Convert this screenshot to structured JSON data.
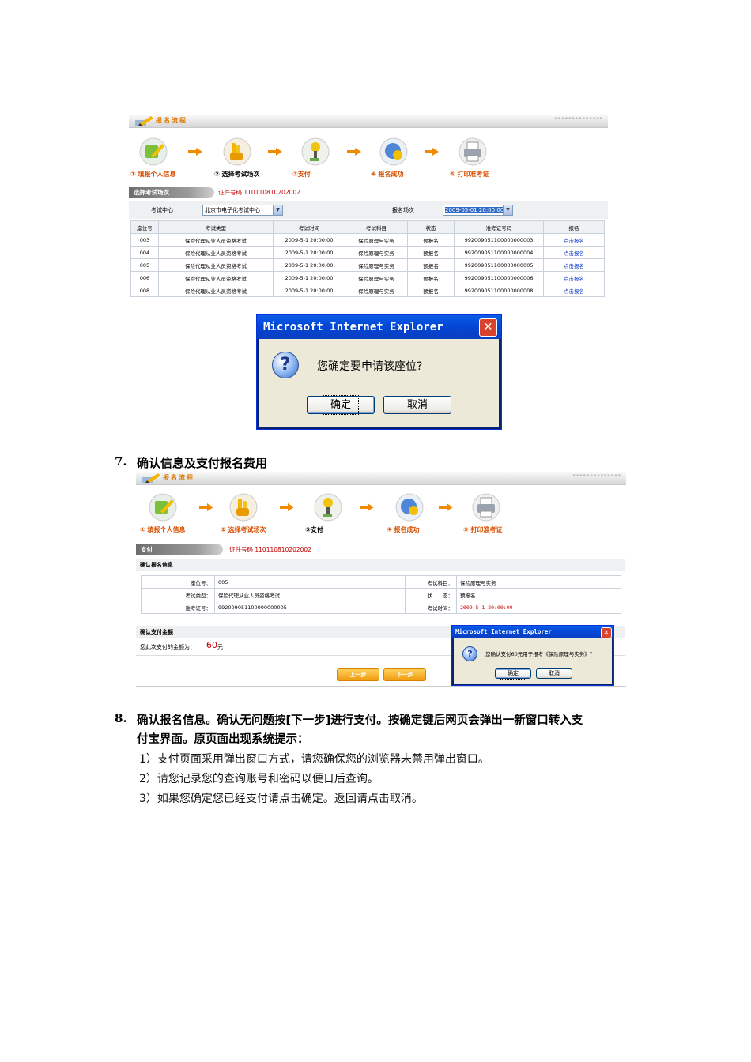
{
  "shot1": {
    "header_title": "报名流程",
    "steps": [
      {
        "label": "① 填报个人信息",
        "icon": "edit-icon"
      },
      {
        "label": "② 选择考试场次",
        "icon": "hand-icon"
      },
      {
        "label": "③支付",
        "icon": "payment-icon"
      },
      {
        "label": "④ 报名成功",
        "icon": "globe-icon"
      },
      {
        "label": "⑤ 打印准考证",
        "icon": "printer-icon"
      }
    ],
    "section_title": "选择考试场次",
    "cert_no": "证件号码 110110810202002",
    "center_label": "考试中心",
    "center_value": "北京市电子化考试中心",
    "session_label": "报名场次",
    "session_value": "2009-05-01 20:00:00",
    "columns": [
      "座位号",
      "考试类型",
      "考试时间",
      "考试科目",
      "状态",
      "准考证号码",
      "报名"
    ],
    "rows": [
      [
        "003",
        "保险代理从业人员资格考试",
        "2009-5-1 20:00:00",
        "保险原理与实务",
        "预报名",
        "992009051100000000003",
        "点击报名"
      ],
      [
        "004",
        "保险代理从业人员资格考试",
        "2009-5-1 20:00:00",
        "保险原理与实务",
        "预报名",
        "992009051100000000004",
        "点击报名"
      ],
      [
        "005",
        "保险代理从业人员资格考试",
        "2009-5-1 20:00:00",
        "保险原理与实务",
        "预报名",
        "992009051100000000005",
        "点击报名"
      ],
      [
        "006",
        "保险代理从业人员资格考试",
        "2009-5-1 20:00:00",
        "保险原理与实务",
        "预报名",
        "992009051100000000006",
        "点击报名"
      ],
      [
        "008",
        "保险代理从业人员资格考试",
        "2009-5-1 20:00:00",
        "保险原理与实务",
        "预报名",
        "992009051100000000008",
        "点击报名"
      ]
    ]
  },
  "dialog1": {
    "title": "Microsoft Internet Explorer",
    "message": "您确定要申请该座位?",
    "ok": "确定",
    "cancel": "取消"
  },
  "section7": {
    "num": "7.",
    "title": "确认信息及支付报名费用"
  },
  "shot2": {
    "header_title": "报名流程",
    "steps": [
      {
        "label": "① 填报个人信息",
        "icon": "edit-icon"
      },
      {
        "label": "② 选择考试场次",
        "icon": "hand-icon"
      },
      {
        "label": "③支付",
        "icon": "payment-icon"
      },
      {
        "label": "④ 报名成功",
        "icon": "globe-icon"
      },
      {
        "label": "⑤ 打印准考证",
        "icon": "printer-icon"
      }
    ],
    "section_title": "支付",
    "cert_no": "证件号码 110110810202002",
    "confirm_title": "确认报名信息",
    "fields": {
      "seat_label": "座位号：",
      "seat": "005",
      "subject_label": "考试科目：",
      "subject": "保险原理与实务",
      "type_label": "考试类型：",
      "type": "保险代理从业人员资格考试",
      "status_label": "状　　态：",
      "status": "预报名",
      "ticket_label": "准考证号：",
      "ticket": "992009051100000000005",
      "time_label": "考试时间：",
      "time": "2009-5-1 20:00:00"
    },
    "pay_title": "确认支付金额",
    "pay_label": "您此次支付的金额为：",
    "amount": "60",
    "amount_unit": "元",
    "prev": "上一步",
    "next": "下一步"
  },
  "dialog2": {
    "title": "Microsoft Internet Explorer",
    "message": "您确认支付60元用于报考《保险原理与实务》？",
    "ok": "确定",
    "cancel": "取消"
  },
  "section8": {
    "num": "8.",
    "line1": "确认报名信息。确认无问题按[下一步]进行支付。按确定键后网页会弹出一新窗口转入支",
    "line2": "付宝界面。原页面出现系统提示：",
    "items": [
      "1）支付页面采用弹出窗口方式，请您确保您的浏览器未禁用弹出窗口。",
      "2）请您记录您的查询账号和密码以便日后查询。",
      "3）如果您确定您已经支付请点击确定。返回请点击取消。"
    ]
  }
}
